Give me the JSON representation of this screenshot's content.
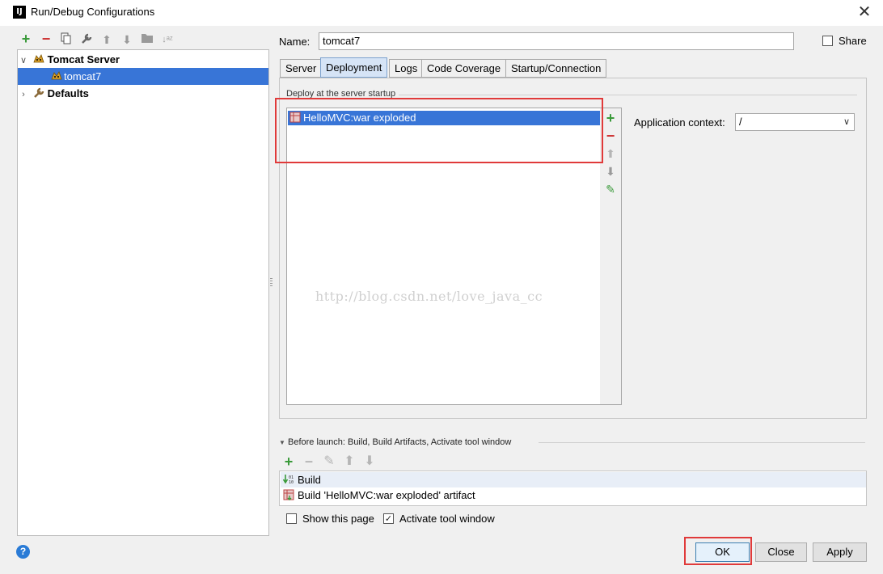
{
  "window": {
    "title": "Run/Debug Configurations",
    "app_icon_text": "IJ"
  },
  "toolbar": {
    "add": "+",
    "remove": "−",
    "copy": "⧉",
    "edit": "🔧",
    "up": "⬆",
    "down": "⬇",
    "folder": "▬",
    "sort": "↓ᵃᶻ"
  },
  "tree": {
    "items": [
      {
        "label": "Tomcat Server",
        "level": 0,
        "expanded": true
      },
      {
        "label": "tomcat7",
        "level": 1,
        "selected": true
      },
      {
        "label": "Defaults",
        "level": 0,
        "expanded": false
      }
    ]
  },
  "form": {
    "name_label": "Name:",
    "name_value": "tomcat7",
    "share_label": "Share",
    "share_checked": false
  },
  "tabs": [
    {
      "label": "Server",
      "active": false
    },
    {
      "label": "Deployment",
      "active": true
    },
    {
      "label": "Logs",
      "active": false
    },
    {
      "label": "Code Coverage",
      "active": false
    },
    {
      "label": "Startup/Connection",
      "active": false
    }
  ],
  "deployment": {
    "group_title": "Deploy at the server startup",
    "items": [
      {
        "label": "HelloMVC:war exploded",
        "selected": true
      }
    ],
    "app_context_label": "Application context:",
    "app_context_value": "/"
  },
  "watermark": "http://blog.csdn.net/love_java_cc",
  "before_launch": {
    "title": "Before launch: Build, Build Artifacts, Activate tool window",
    "items": [
      {
        "label": "Build"
      },
      {
        "label": "Build 'HelloMVC:war exploded' artifact"
      }
    ]
  },
  "options": {
    "show_this_page": "Show this page",
    "show_this_page_checked": false,
    "activate_tool_window": "Activate tool window",
    "activate_tool_window_checked": true
  },
  "buttons": {
    "ok": "OK",
    "close": "Close",
    "apply": "Apply",
    "help": "?"
  },
  "colors": {
    "selection": "#3875d7",
    "highlight_box": "#e03a3a",
    "add_green": "#3a9a3a",
    "remove_red": "#cc3333"
  }
}
